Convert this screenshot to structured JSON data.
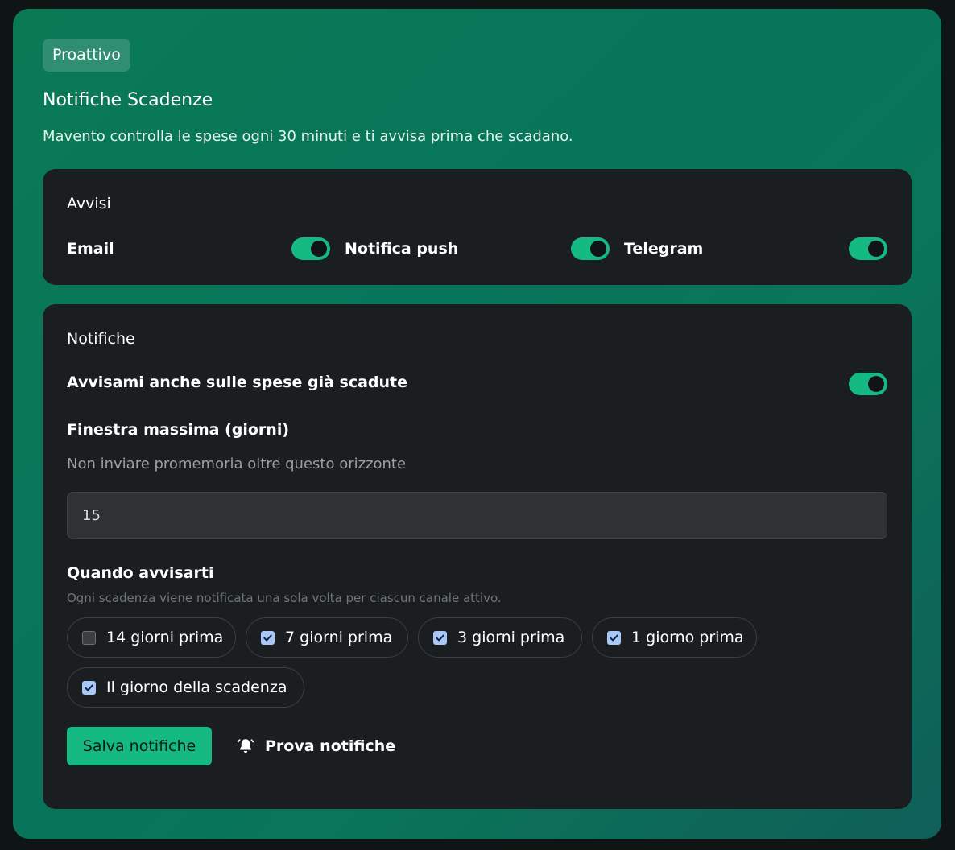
{
  "section": {
    "badge": "Proattivo",
    "title": "Notifiche Scadenze",
    "description": "Mavento controlla le spese ogni 30 minuti e ti avvisa prima che scadano."
  },
  "avvisi": {
    "heading": "Avvisi",
    "channels": [
      {
        "label": "Email",
        "enabled": true
      },
      {
        "label": "Notifica push",
        "enabled": true
      },
      {
        "label": "Telegram",
        "enabled": true
      }
    ]
  },
  "notifiche": {
    "heading": "Notifiche",
    "overdue_label": "Avvisami anche sulle spese già scadute",
    "overdue_enabled": true,
    "window_label": "Finestra massima (giorni)",
    "window_hint": "Non inviare promemoria oltre questo orizzonte",
    "window_value": "15",
    "when_label": "Quando avvisarti",
    "when_hint": "Ogni scadenza viene notificata una sola volta per ciascun canale attivo.",
    "options": [
      {
        "label": "14 giorni prima",
        "checked": false
      },
      {
        "label": "7 giorni prima",
        "checked": true
      },
      {
        "label": "3 giorni prima",
        "checked": true
      },
      {
        "label": "1 giorno prima",
        "checked": true
      },
      {
        "label": "Il giorno della scadenza",
        "checked": true
      }
    ],
    "save_label": "Salva notifiche",
    "test_label": "Prova notifiche"
  },
  "colors": {
    "accent": "#15b982",
    "card": "#1b1e20",
    "checkbox_checked": "#a9c8f7"
  }
}
